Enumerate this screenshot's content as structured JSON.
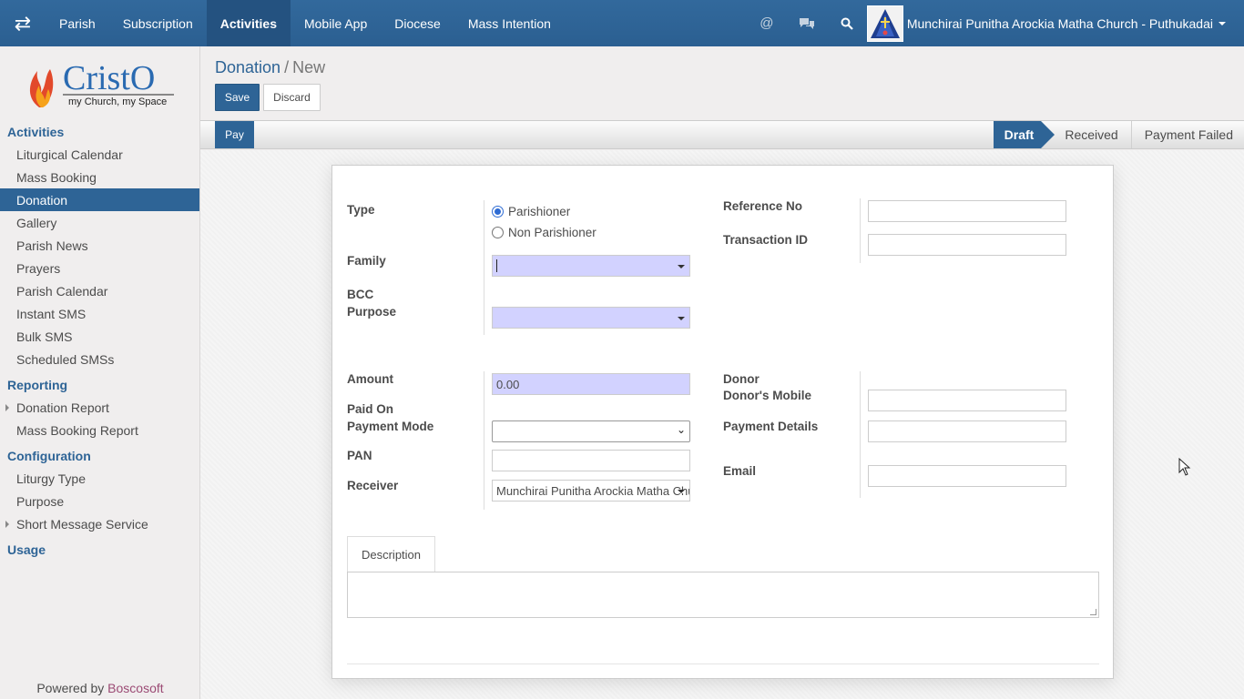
{
  "topbar": {
    "nav": [
      "Parish",
      "Subscription",
      "Activities",
      "Mobile App",
      "Diocese",
      "Mass Intention"
    ],
    "active_nav": "Activities",
    "church_name": "Munchirai Punitha Arockia Matha Church - Puthukadai",
    "icons": [
      "app-switch-icon",
      "at-icon",
      "chat-icon",
      "search-icon"
    ]
  },
  "brand": {
    "name": "CristO",
    "tagline": "my Church, my Space"
  },
  "sidebar": {
    "activities_title": "Activities",
    "activities": [
      "Liturgical Calendar",
      "Mass Booking",
      "Donation",
      "Gallery",
      "Parish News",
      "Prayers",
      "Parish Calendar",
      "Instant SMS",
      "Bulk SMS",
      "Scheduled SMSs"
    ],
    "reporting_title": "Reporting",
    "reporting": [
      "Donation Report",
      "Mass Booking Report"
    ],
    "configuration_title": "Configuration",
    "configuration": [
      "Liturgy Type",
      "Purpose",
      "Short Message Service"
    ],
    "usage_title": "Usage",
    "powered_prefix": "Powered by",
    "powered_brand": "Boscosoft"
  },
  "breadcrumb": {
    "parent": "Donation",
    "separator": "/",
    "current": "New"
  },
  "buttons": {
    "save": "Save",
    "discard": "Discard",
    "pay": "Pay"
  },
  "stages": [
    "Draft",
    "Received",
    "Payment Failed"
  ],
  "active_stage": "Draft",
  "form": {
    "type_label": "Type",
    "type_options": [
      "Parishioner",
      "Non Parishioner"
    ],
    "type_selected": "Parishioner",
    "family_label": "Family",
    "family_value": "",
    "bcc_label": "BCC",
    "purpose_label": "Purpose",
    "purpose_value": "",
    "reference_label": "Reference No",
    "reference_value": "",
    "transaction_label": "Transaction ID",
    "transaction_value": "",
    "amount_label": "Amount",
    "amount_value": "0.00",
    "paid_on_label": "Paid On",
    "payment_mode_label": "Payment Mode",
    "payment_mode_value": "",
    "pan_label": "PAN",
    "pan_value": "",
    "receiver_label": "Receiver",
    "receiver_value": "Munchirai Punitha Arockia Matha Church - Puthukadai",
    "donor_label": "Donor",
    "donor_mobile_label": "Donor's Mobile",
    "donor_mobile_value": "",
    "payment_details_label": "Payment Details",
    "payment_details_value": "",
    "email_label": "Email",
    "email_value": "",
    "description_tab": "Description",
    "description_value": ""
  },
  "colors": {
    "primary": "#2e6496",
    "required_field": "#d2d2ff",
    "brand_accent": "#9b4a74"
  }
}
